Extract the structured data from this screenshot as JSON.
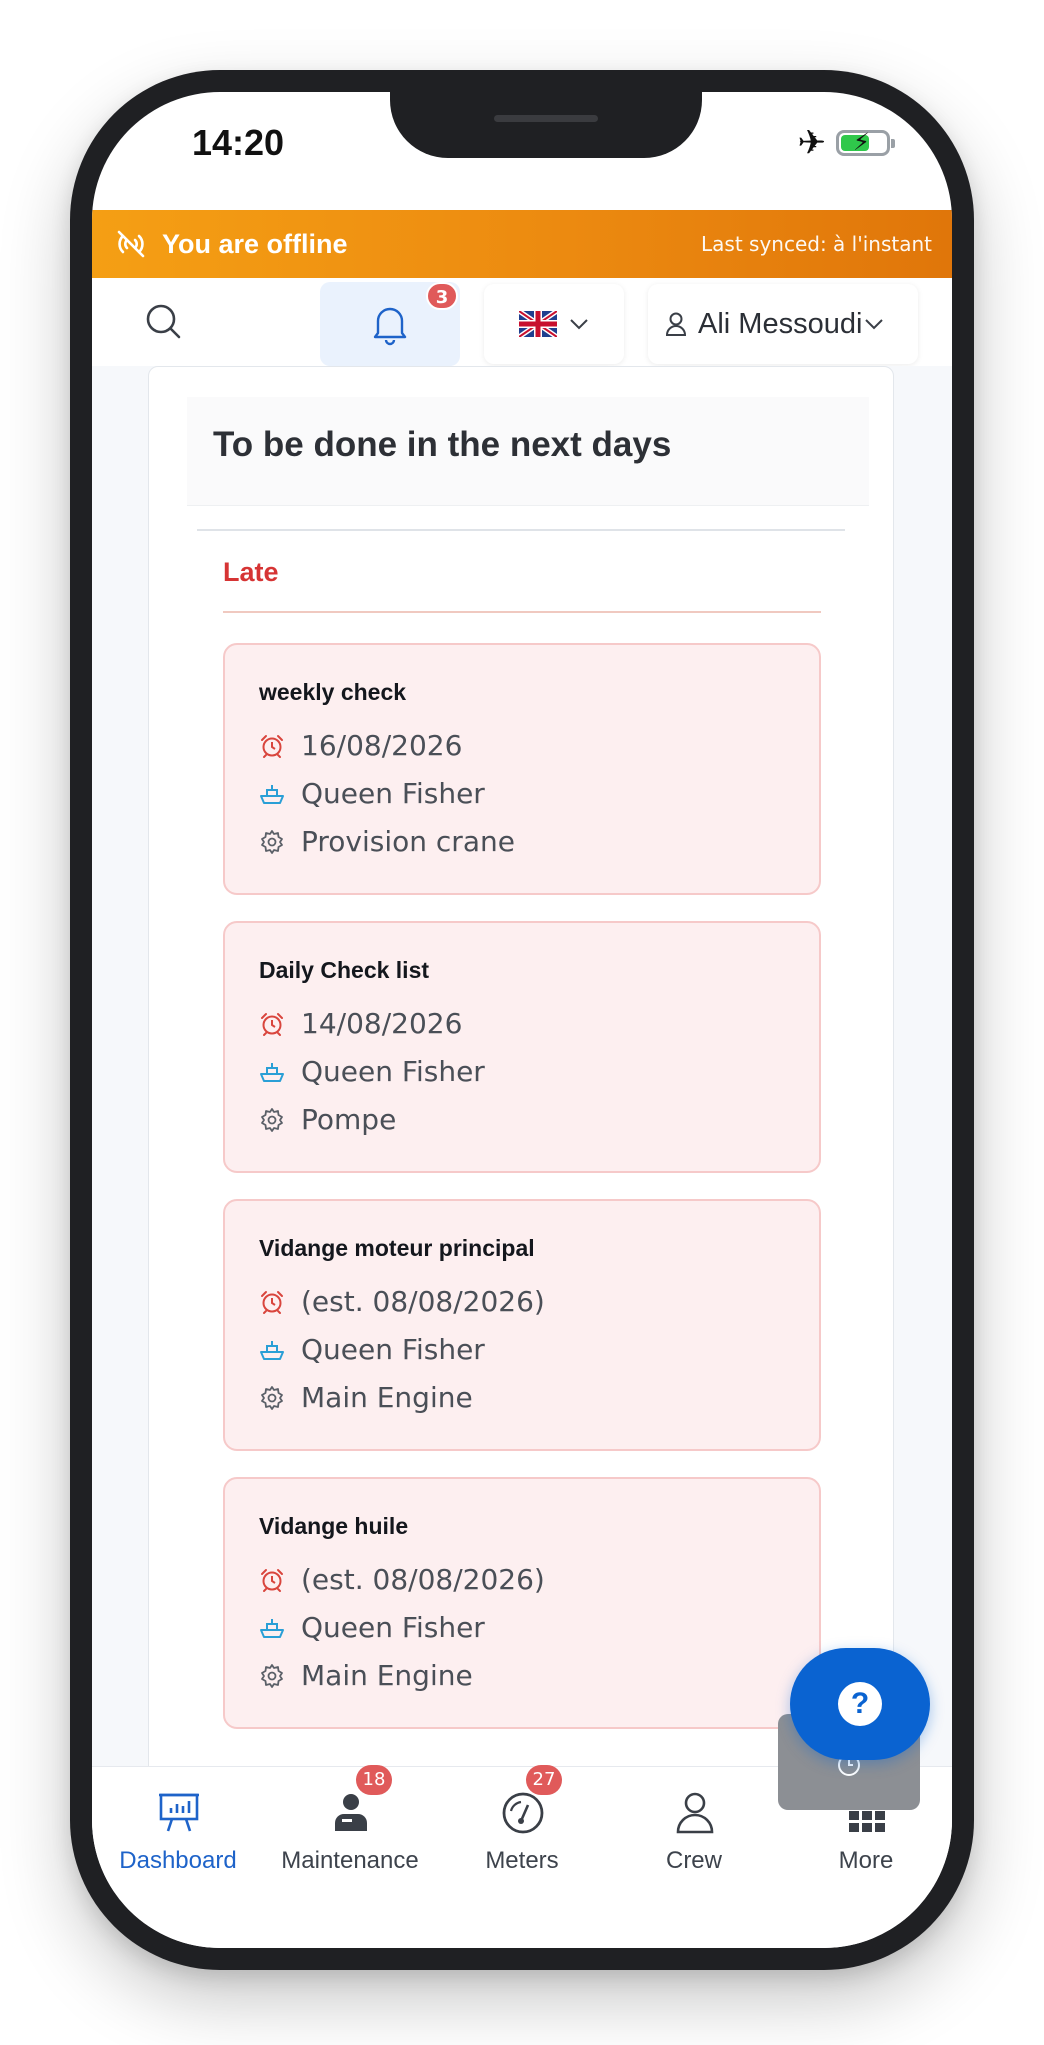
{
  "status_bar": {
    "time": "14:20"
  },
  "offline_banner": {
    "message": "You are offline",
    "last_synced": "Last synced: à l'instant"
  },
  "header": {
    "notifications_count": "3",
    "user_name": "Ali Messoudi"
  },
  "card": {
    "title": "To be done in the next days",
    "section": "Late",
    "tasks": [
      {
        "title": "weekly check",
        "date": "16/08/2026",
        "vessel": "Queen Fisher",
        "equipment": "Provision crane"
      },
      {
        "title": "Daily Check list",
        "date": "14/08/2026",
        "vessel": "Queen Fisher",
        "equipment": "Pompe"
      },
      {
        "title": "Vidange moteur principal",
        "date": "(est. 08/08/2026)",
        "vessel": "Queen Fisher",
        "equipment": "Main Engine"
      },
      {
        "title": "Vidange huile",
        "date": "(est. 08/08/2026)",
        "vessel": "Queen Fisher",
        "equipment": "Main Engine"
      }
    ]
  },
  "help_button": {
    "label": "?"
  },
  "bottom_nav": {
    "items": [
      {
        "label": "Dashboard",
        "badge": ""
      },
      {
        "label": "Maintenance",
        "badge": "18"
      },
      {
        "label": "Meters",
        "badge": "27"
      },
      {
        "label": "Crew",
        "badge": ""
      },
      {
        "label": "More",
        "badge": ""
      }
    ]
  },
  "colors": {
    "accent": "#0a63d1",
    "offline": "#f59f14",
    "late": "#d63434",
    "task_bg": "#fdeff0"
  }
}
